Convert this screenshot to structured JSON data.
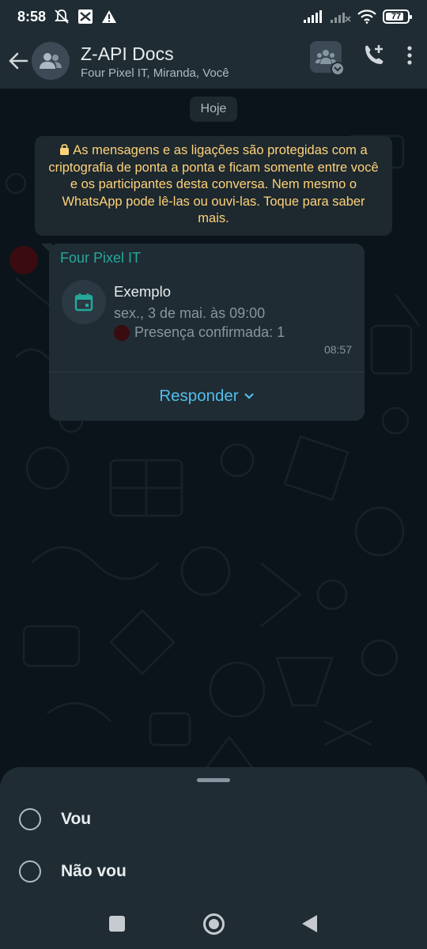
{
  "status_bar": {
    "time": "8:58",
    "battery": "77"
  },
  "header": {
    "title": "Z-API Docs",
    "subtitle": "Four Pixel IT, Miranda, Você"
  },
  "chat": {
    "date_chip": "Hoje",
    "encryption_note": "As mensagens e as ligações são protegidas com a criptografia de ponta a ponta e ficam somente entre você e os participantes desta conversa. Nem mesmo o WhatsApp pode lê-las ou ouvi-las. Toque para saber mais.",
    "message": {
      "sender": "Four Pixel IT",
      "event_title": "Exemplo",
      "event_date": "sex., 3 de mai. às 09:00",
      "attendance": "Presença confirmada: 1",
      "time": "08:57",
      "reply_label": "Responder"
    }
  },
  "bottom_sheet": {
    "options": [
      {
        "label": "Vou"
      },
      {
        "label": "Não vou"
      }
    ]
  },
  "colors": {
    "accent_green": "#25a89b",
    "link_blue": "#53bdeb",
    "note_yellow": "#ffd279",
    "background": "#0b141a"
  }
}
